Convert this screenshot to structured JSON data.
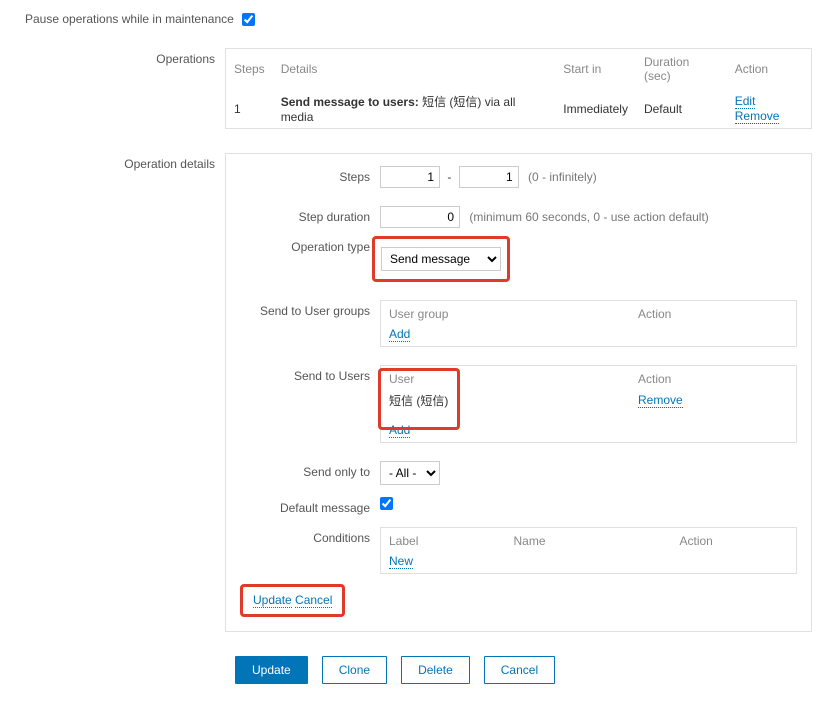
{
  "pause": {
    "label": "Pause operations while in maintenance",
    "checked": true
  },
  "operations": {
    "label": "Operations",
    "headers": {
      "steps": "Steps",
      "details": "Details",
      "start": "Start in",
      "duration": "Duration (sec)",
      "action": "Action"
    },
    "row": {
      "step": "1",
      "details_prefix": "Send message to users:",
      "details_rest": " 短信 (短信) via all media",
      "start": "Immediately",
      "duration": "Default",
      "edit": "Edit",
      "remove": "Remove"
    }
  },
  "details": {
    "label": "Operation details",
    "steps": {
      "label": "Steps",
      "from": "1",
      "to": "1",
      "hint": "(0 - infinitely)"
    },
    "stepDuration": {
      "label": "Step duration",
      "value": "0",
      "hint": "(minimum 60 seconds, 0 - use action default)"
    },
    "opType": {
      "label": "Operation type",
      "value": "Send message"
    },
    "sendGroups": {
      "label": "Send to User groups",
      "hdr_group": "User group",
      "hdr_action": "Action",
      "add": "Add"
    },
    "sendUsers": {
      "label": "Send to Users",
      "hdr_user": "User",
      "hdr_action": "Action",
      "user": "短信 (短信)",
      "remove": "Remove",
      "add": "Add"
    },
    "sendOnly": {
      "label": "Send only to",
      "value": "- All -"
    },
    "defaultMsg": {
      "label": "Default message",
      "checked": true
    },
    "conditions": {
      "label": "Conditions",
      "hdr_label": "Label",
      "hdr_name": "Name",
      "hdr_action": "Action",
      "new": "New"
    },
    "inline": {
      "update": "Update",
      "cancel": "Cancel"
    }
  },
  "footer": {
    "update": "Update",
    "clone": "Clone",
    "delete": "Delete",
    "cancel": "Cancel"
  }
}
